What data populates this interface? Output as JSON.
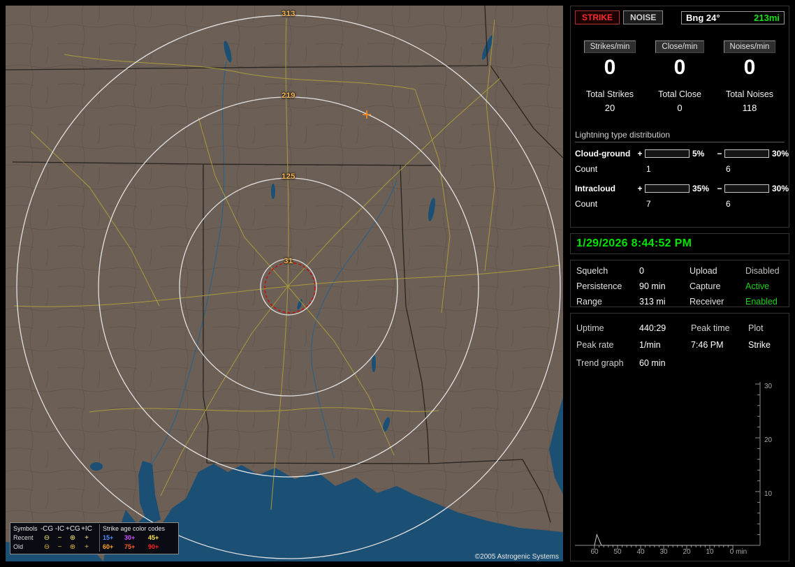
{
  "colors": {
    "accent_green": "#1ae01a",
    "status_green": "#1ad21a",
    "status_dim": "#bdbdbd",
    "strike_red": "#ff2a2a",
    "ring_label": "#ffb84d",
    "water": "#1c4f74",
    "land": "#6c5f56"
  },
  "map": {
    "ring_labels": [
      "313",
      "219",
      "125",
      "31"
    ],
    "copyright": "©2005 Astrogenic Systems",
    "legend": {
      "symbols_title": "Symbols",
      "symbol_columns": [
        "-CG",
        "-IC",
        "+CG",
        "+IC"
      ],
      "age_title": "Strike age color codes",
      "rows": [
        {
          "label": "Recent",
          "symbols": [
            "⊖",
            "−",
            "⊕",
            "+"
          ],
          "symbol_color": "#f2ec74",
          "ages": [
            {
              "text": "15+",
              "color": "#4f8cff"
            },
            {
              "text": "30+",
              "color": "#d24fff"
            },
            {
              "text": "45+",
              "color": "#ffe84f"
            }
          ]
        },
        {
          "label": "Old",
          "symbols": [
            "⊖",
            "−",
            "⊕",
            "+"
          ],
          "symbol_color": "#d8b23a",
          "ages": [
            {
              "text": "60+",
              "color": "#ffa51f"
            },
            {
              "text": "75+",
              "color": "#ff611f"
            },
            {
              "text": "90+",
              "color": "#ff231f"
            }
          ]
        }
      ]
    }
  },
  "panel": {
    "strike_button": "STRIKE",
    "noise_button": "NOISE",
    "bearing": {
      "label": "Bng 24°",
      "distance": "213mi"
    },
    "rates": [
      {
        "badge": "Strikes/min",
        "value": "0",
        "total_label": "Total Strikes",
        "total_value": "20"
      },
      {
        "badge": "Close/min",
        "value": "0",
        "total_label": "Total Close",
        "total_value": "0"
      },
      {
        "badge": "Noises/min",
        "value": "0",
        "total_label": "Total Noises",
        "total_value": "118"
      }
    ],
    "distribution": {
      "title": "Lightning type distribution",
      "rows": [
        {
          "label": "Cloud-ground",
          "plus_sign": "+",
          "plus_pct_num": 5,
          "plus_pct": "5%",
          "plus_color": "#e8231c",
          "minus_sign": "−",
          "minus_pct_num": 30,
          "minus_pct": "30%",
          "minus_color": "#5d8fe8",
          "count_label": "Count",
          "plus_count": "1",
          "minus_count": "6"
        },
        {
          "label": "Intracloud",
          "plus_sign": "+",
          "plus_pct_num": 35,
          "plus_pct": "35%",
          "plus_color": "#f060c8",
          "minus_sign": "−",
          "minus_pct_num": 30,
          "minus_pct": "30%",
          "minus_color": "#25e025",
          "count_label": "Count",
          "plus_count": "7",
          "minus_count": "6"
        }
      ]
    },
    "datetime": "1/29/2026 8:44:52 PM",
    "settings": {
      "rows": [
        {
          "l1": "Squelch",
          "v1": "0",
          "l2": "Upload",
          "v2": "Disabled",
          "v2_color": "#bdbdbd"
        },
        {
          "l1": "Persistence",
          "v1": "90 min",
          "l2": "Capture",
          "v2": "Active",
          "v2_color": "#1ad21a"
        },
        {
          "l1": "Range",
          "v1": "313 mi",
          "l2": "Receiver",
          "v2": "Enabled",
          "v2_color": "#1ad21a"
        }
      ]
    },
    "stats": {
      "rows": [
        {
          "c1": "Uptime",
          "c2": "440:29",
          "c3": "Peak time",
          "c4": "Plot"
        },
        {
          "c1": "Peak rate",
          "c2": "1/min",
          "c3": "7:46 PM",
          "c4": "Strike"
        }
      ],
      "trend_label": "Trend graph",
      "trend_value": "60 min"
    }
  },
  "chart_data": {
    "type": "line",
    "title": "Strike trend graph (strikes per minute over last 60 minutes)",
    "xlabel": "min",
    "ylabel": "",
    "xlim": [
      60,
      0
    ],
    "ylim": [
      0,
      30
    ],
    "x_ticks": [
      "60",
      "50",
      "40",
      "30",
      "20",
      "10",
      "0 min"
    ],
    "y_ticks": [
      "30",
      "20",
      "10"
    ],
    "grid": false,
    "legend_position": "none",
    "series": [
      {
        "name": "Strike",
        "points": [
          {
            "x": 60,
            "y": 0
          },
          {
            "x": 59,
            "y": 2
          },
          {
            "x": 57,
            "y": 0
          },
          {
            "x": 0,
            "y": 0
          }
        ]
      }
    ]
  }
}
